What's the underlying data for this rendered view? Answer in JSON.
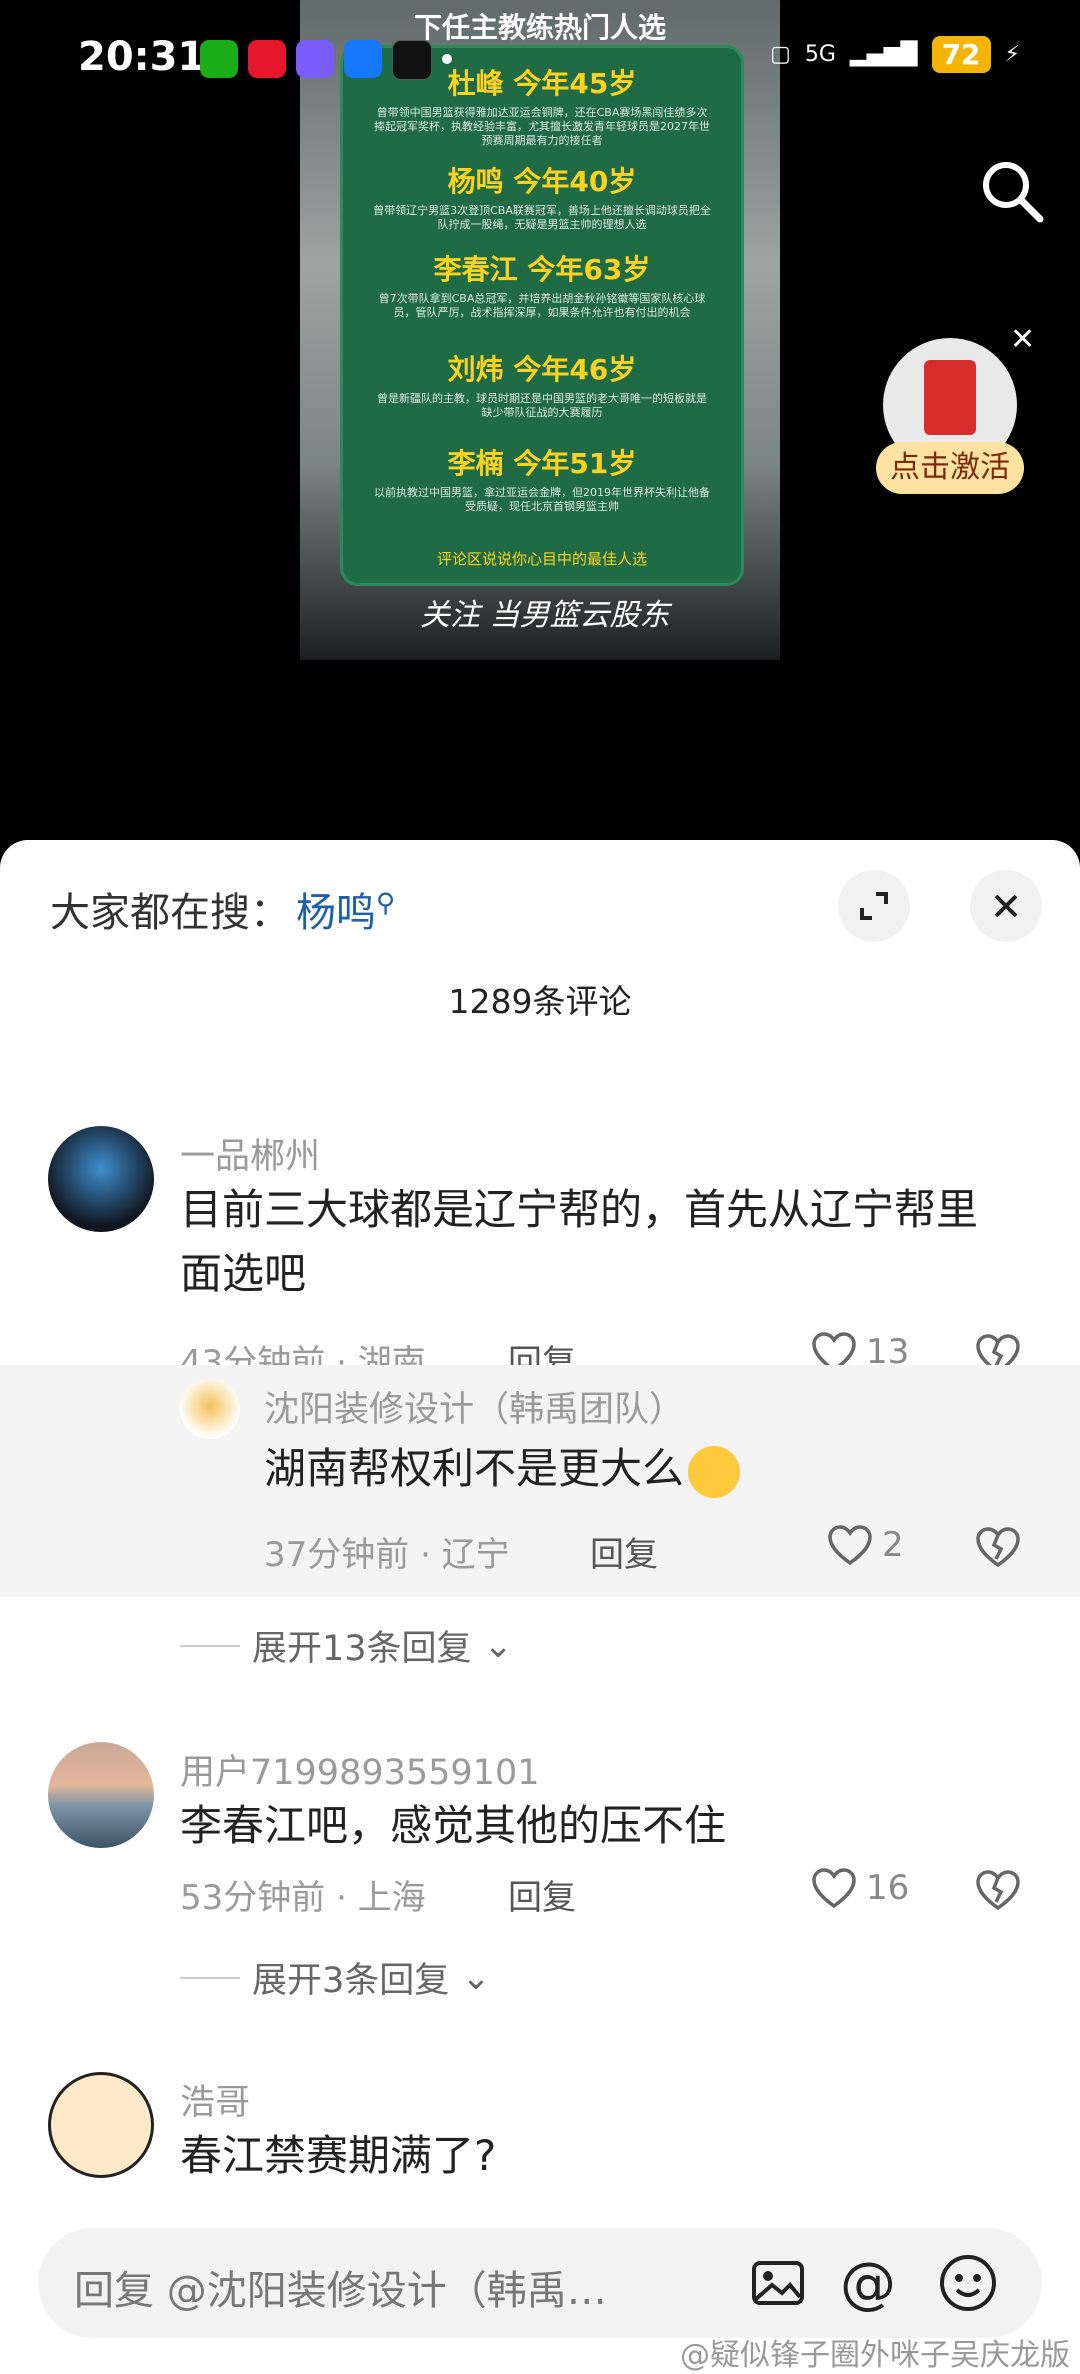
{
  "status_bar": {
    "time": "20:31",
    "network": "5G",
    "battery": "72"
  },
  "video": {
    "poster_top": "下任主教练热门人选",
    "coaches": [
      {
        "name": "杜峰 今年45岁",
        "desc": "曾带领中国男篮获得雅加达亚运会铜牌，还在CBA赛场黑闯佳绩多次捧起冠军奖杯，执教经验丰富，尤其擅长激发青年轻球员是2027年世预赛周期最有力的接任者"
      },
      {
        "name": "杨鸣 今年40岁",
        "desc": "曾带领辽宁男篮3次登顶CBA联赛冠军，善场上他还擅长调动球员把全队拧成一股绳，无疑是男篮主帅的理想人选"
      },
      {
        "name": "李春江 今年63岁",
        "desc": "曾7次带队拿到CBA总冠军，并培养出胡金秋孙铭徽等国家队核心球员，管队严厉，战术指挥深厚，如果条件允许也有付出的机会"
      },
      {
        "name": "刘炜 今年46岁",
        "desc": "曾是新疆队的主教，球员时期还是中国男篮的老大哥唯一的短板就是缺少带队征战的大赛履历"
      },
      {
        "name": "李楠 今年51岁",
        "desc": "以前执教过中国男篮，拿过亚运会金牌，但2019年世界杯失利让他备受质疑，现任北京首钢男篮主帅"
      }
    ],
    "poster_footer": "评论区说说你心目中的最佳人选",
    "signature": "关注 当男篮云股东",
    "redpacket_label": "点击激活"
  },
  "comments_sheet": {
    "trending_prefix": "大家都在搜：",
    "trending_keyword": "杨鸣",
    "count_label": "1289条评论",
    "reply_label": "回复",
    "comments": [
      {
        "user": "一品郴州",
        "text": "目前三大球都是辽宁帮的，首先从辽宁帮里面选吧",
        "meta": "43分钟前 · 湖南",
        "likes": "13"
      },
      {
        "user": "用户7199893559101",
        "text": "李春江吧，感觉其他的压不住",
        "meta": "53分钟前 · 上海",
        "likes": "16"
      },
      {
        "user": "浩哥",
        "text": "春江禁赛期满了?",
        "meta": "",
        "likes": ""
      }
    ],
    "reply": {
      "user": "沈阳装修设计（韩禹团队）",
      "text": "湖南帮权利不是更大么",
      "meta": "37分钟前 · 辽宁",
      "likes": "2"
    },
    "expand_labels": [
      "展开13条回复",
      "展开3条回复"
    ],
    "input_placeholder": "回复 @沈阳装修设计（韩禹…"
  },
  "watermark": "@疑似锋子圈外咪子吴庆龙版"
}
